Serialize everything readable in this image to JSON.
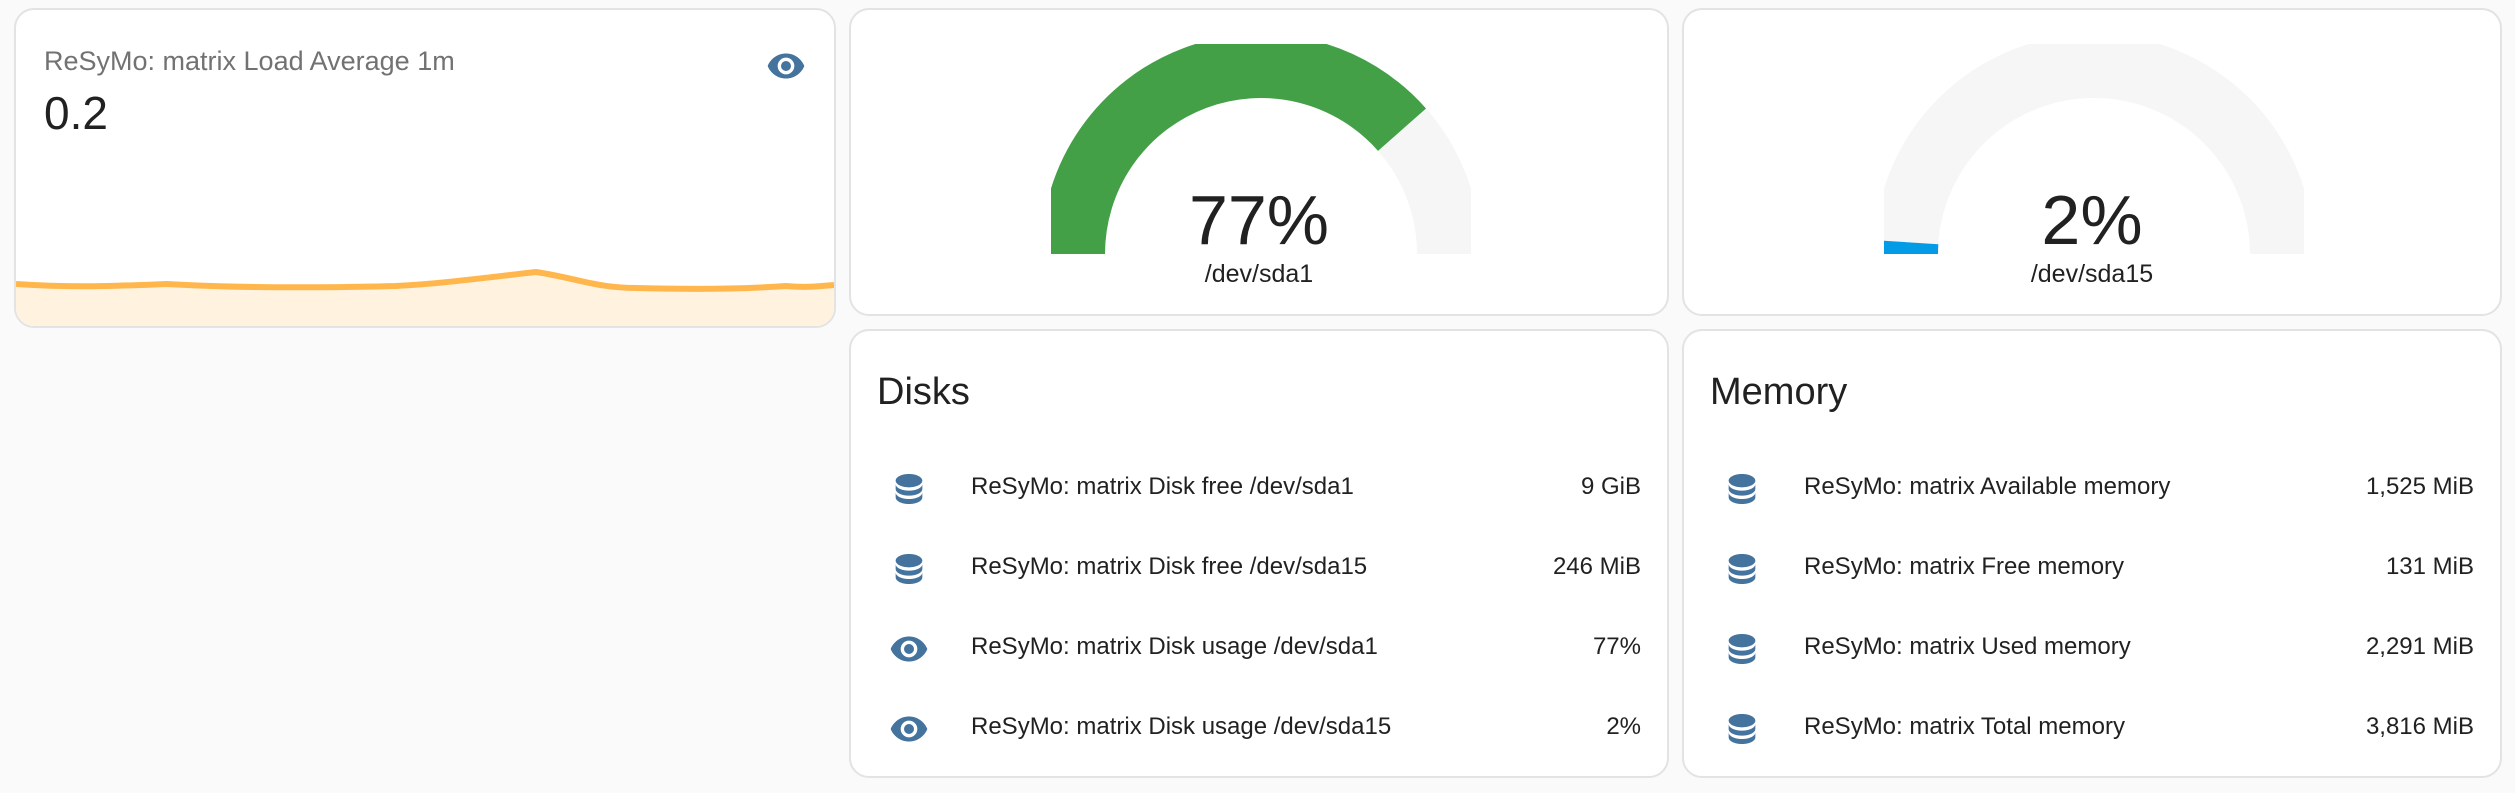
{
  "colors": {
    "icon": "#44739e",
    "gauge_green": "#43a047",
    "gauge_blue": "#039be5",
    "gauge_track": "#f6f6f6",
    "graph_line": "#ffb74d"
  },
  "sensor_card": {
    "name": "ReSyMo: matrix Load Average 1m",
    "value": "0.2",
    "icon": "eye-icon"
  },
  "gauges": [
    {
      "value_text": "77%",
      "name": "/dev/sda1",
      "level_percent": 77,
      "color": "#43a047"
    },
    {
      "value_text": "2%",
      "name": "/dev/sda15",
      "level_percent": 2,
      "color": "#039be5"
    }
  ],
  "disks": {
    "title": "Disks",
    "rows": [
      {
        "icon": "database-icon",
        "label": "ReSyMo: matrix Disk free /dev/sda1",
        "value": "9 GiB"
      },
      {
        "icon": "database-icon",
        "label": "ReSyMo: matrix Disk free /dev/sda15",
        "value": "246 MiB"
      },
      {
        "icon": "eye-icon",
        "label": "ReSyMo: matrix Disk usage /dev/sda1",
        "value": "77%"
      },
      {
        "icon": "eye-icon",
        "label": "ReSyMo: matrix Disk usage /dev/sda15",
        "value": "2%"
      }
    ]
  },
  "memory": {
    "title": "Memory",
    "rows": [
      {
        "icon": "database-icon",
        "label": "ReSyMo: matrix Available memory",
        "value": "1,525 MiB"
      },
      {
        "icon": "database-icon",
        "label": "ReSyMo: matrix Free memory",
        "value": "131 MiB"
      },
      {
        "icon": "database-icon",
        "label": "ReSyMo: matrix Used memory",
        "value": "2,291 MiB"
      },
      {
        "icon": "database-icon",
        "label": "ReSyMo: matrix Total memory",
        "value": "3,816 MiB"
      }
    ]
  }
}
